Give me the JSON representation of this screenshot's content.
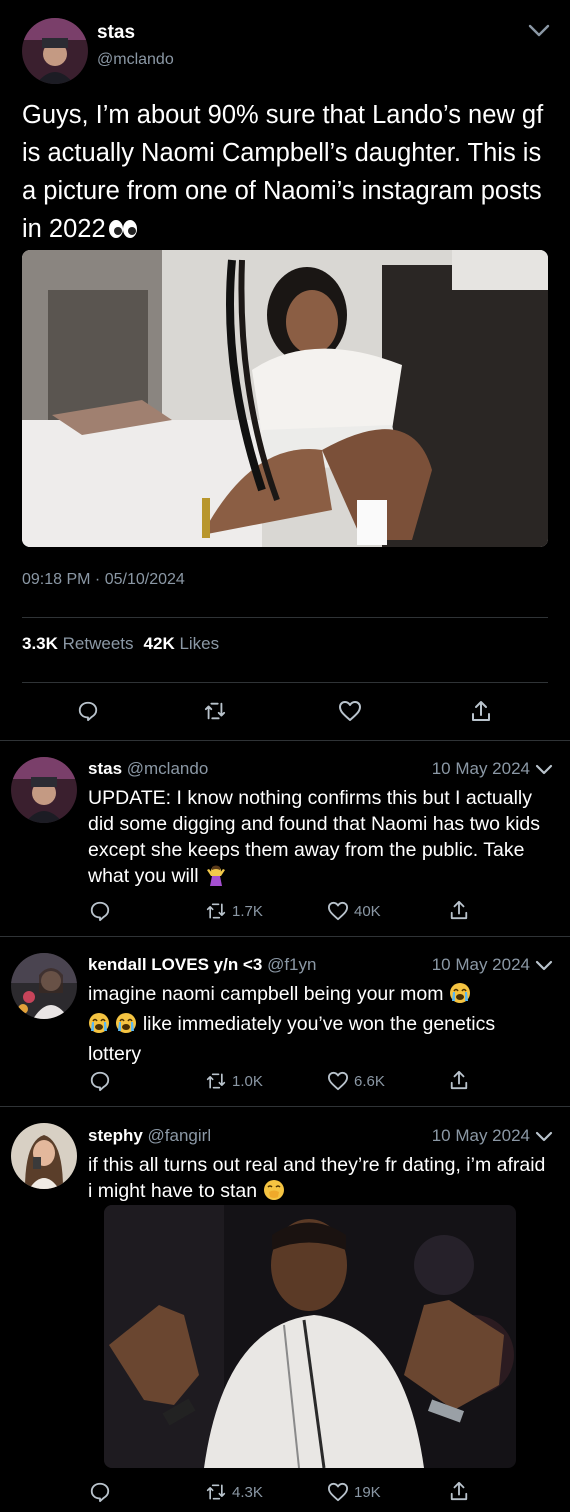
{
  "main_tweet": {
    "author_name": "stas",
    "author_handle": "@mclando",
    "text": "Guys, I’m about 90% sure that Lando’s new gf is actually Naomi Campbell’s daughter. This is a picture from one of Naomi’s instagram posts in 2022",
    "timestamp": "09:18 PM · 05/10/2024",
    "retweets_count": "3.3K",
    "retweets_label": "Retweets",
    "likes_count": "42K",
    "likes_label": "Likes"
  },
  "replies": [
    {
      "name": "stas",
      "handle": "@mclando",
      "date": "10 May 2024",
      "text": "UPDATE: I know nothing confirms this but I actually did some digging and found that Naomi has two kids except she keeps them away from the public. Take what you will",
      "retweets": "1.7K",
      "likes": "40K"
    },
    {
      "name": "kendall LOVES y/n <3",
      "handle": "@f1yn",
      "date": "10 May 2024",
      "text": "imagine naomi campbell being your mom",
      "text_line2": "like immediately you’ve won the genetics lottery",
      "retweets": "1.0K",
      "likes": "6.6K"
    },
    {
      "name": "stephy",
      "handle": "@fangirl",
      "date": "10 May 2024",
      "text": "if this all turns out real and they’re fr dating, i’m afraid i might have to stan",
      "retweets": "4.3K",
      "likes": "19K"
    }
  ],
  "colors": {
    "background": "#000000",
    "text": "#e7e9ea",
    "muted": "#8b98a5",
    "divider": "#2f3336"
  }
}
